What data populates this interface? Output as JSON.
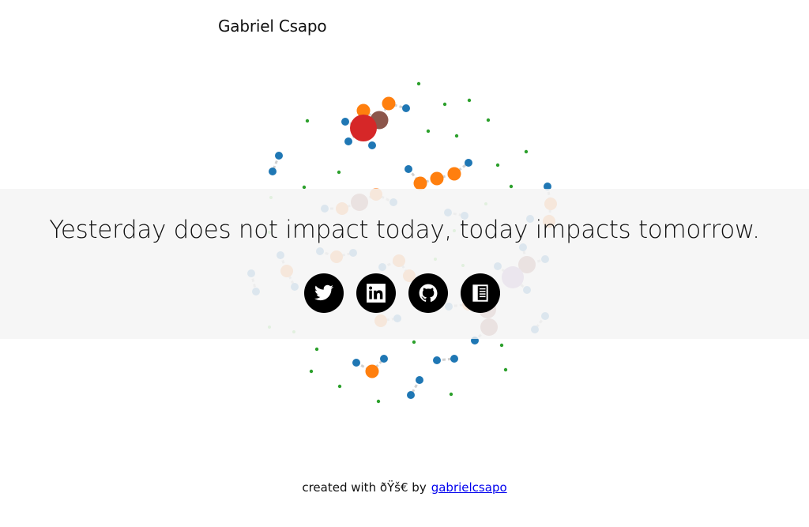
{
  "header": {
    "name": "Gabriel Csapo"
  },
  "hero": {
    "tagline": "Yesterday does not impact today, today impacts tomorrow."
  },
  "social_links": [
    {
      "icon": "twitter-icon"
    },
    {
      "icon": "linkedin-icon"
    },
    {
      "icon": "github-icon"
    },
    {
      "icon": "book-icon"
    }
  ],
  "footer": {
    "created_text": "created with ðŸš€ by",
    "author_link": "gabrielcsapo"
  },
  "colors": {
    "dark_blue": "#1f77b4",
    "light_blue": "#7eafd6",
    "orange": "#ff7f0e",
    "light_orange": "#ffb27a",
    "green": "#2ca02c",
    "light_green": "#98df8a",
    "red": "#d62728",
    "brown": "#8c564b",
    "mauve": "#c49c94",
    "purple": "#c5b0d5",
    "link_gray": "#d0d0d0"
  }
}
